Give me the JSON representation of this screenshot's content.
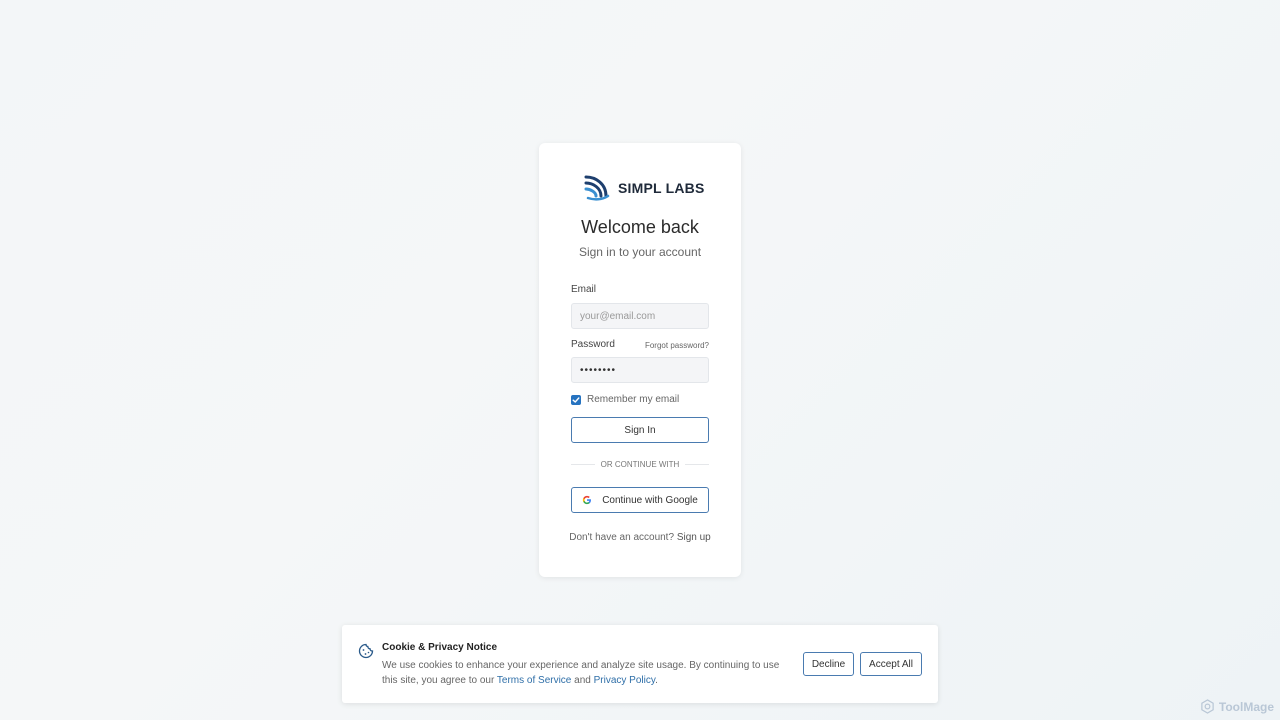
{
  "brand": {
    "name": "SIMPL LABS",
    "logo_icon": "simpl-labs-logo"
  },
  "login": {
    "title": "Welcome back",
    "subtitle": "Sign in to your account",
    "email_label": "Email",
    "email_placeholder": "your@email.com",
    "email_value": "",
    "password_label": "Password",
    "password_value": "••••••••",
    "forgot_link": "Forgot password?",
    "remember_label": "Remember my email",
    "remember_checked": true,
    "sign_in_button": "Sign In",
    "divider_text": "OR CONTINUE WITH",
    "google_button": "Continue with Google",
    "signup_prompt": "Don't have an account?",
    "signup_link": "Sign up"
  },
  "cookie": {
    "title": "Cookie & Privacy Notice",
    "text_before": "We use cookies to enhance your experience and analyze site usage. By continuing to use this site, you agree to our",
    "terms_link": "Terms of Service",
    "and": "and",
    "privacy_link": "Privacy Policy",
    "period": ".",
    "decline_button": "Decline",
    "accept_button": "Accept All"
  },
  "watermark": {
    "text": "ToolMage"
  },
  "colors": {
    "accent": "#2673c0",
    "button_border": "#4a7bb0",
    "link": "#2f6fa8"
  }
}
